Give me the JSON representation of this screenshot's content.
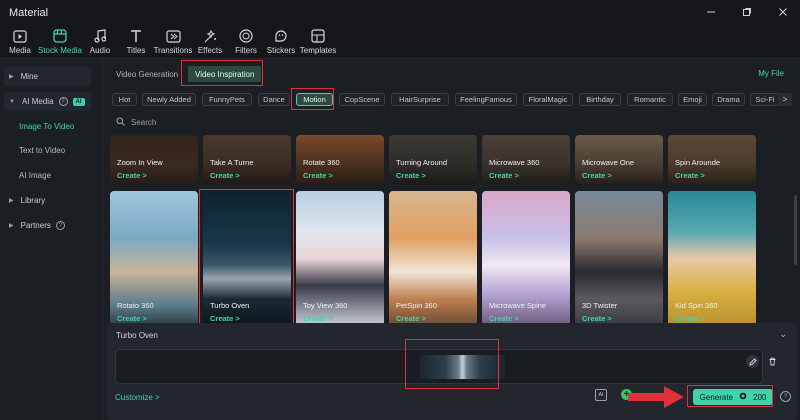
{
  "window": {
    "title": "Material"
  },
  "toolbar": [
    {
      "label": "Media",
      "icon": "media-icon"
    },
    {
      "label": "Stock Media",
      "icon": "stock-media-icon",
      "active": true
    },
    {
      "label": "Audio",
      "icon": "audio-icon"
    },
    {
      "label": "Titles",
      "icon": "titles-icon"
    },
    {
      "label": "Transitions",
      "icon": "transitions-icon"
    },
    {
      "label": "Effects",
      "icon": "effects-icon"
    },
    {
      "label": "Filters",
      "icon": "filters-icon"
    },
    {
      "label": "Stickers",
      "icon": "stickers-icon"
    },
    {
      "label": "Templates",
      "icon": "templates-icon"
    }
  ],
  "sidebar": {
    "mine": "Mine",
    "ai_media": "AI Media",
    "ai_badge": "AI",
    "sub_items": [
      "Image To Video",
      "Text to Video",
      "AI Image"
    ],
    "library": "Library",
    "partners": "Partners"
  },
  "tabs": {
    "video_generation": "Video Generation",
    "video_inspiration": "Video Inspiration",
    "my_file": "My File"
  },
  "categories": [
    "Hot",
    "Newly Added",
    "FunnyPets",
    "Dance",
    "Motion",
    "CopScene",
    "HairSurprise",
    "FeelingFamous",
    "FloralMagic",
    "Birthday",
    "Romantic",
    "Emoji",
    "Drama",
    "Sci-Fi"
  ],
  "active_category": "Motion",
  "search": {
    "placeholder": "Search"
  },
  "create_label": "Create  >",
  "cards_row1": [
    "Zoom In View",
    "Take A Turne",
    "Rotate 360",
    "Turning Around",
    "Microwave 360",
    "Microwave One",
    "Spin Arounde"
  ],
  "cards_row2": [
    "Rotato 360",
    "Turbo Oven",
    "Toy View 360",
    "PetSpin 360",
    "Microwave Spine",
    "3D Twister",
    "Kid Spin 360"
  ],
  "bottom": {
    "selected_title": "Turbo Oven",
    "customize": "Customize  >",
    "generate_label": "Generate",
    "credits": "200"
  },
  "colors": {
    "accent": "#41d4b0",
    "highlight": "#e0313a",
    "background": "#1b1e23"
  }
}
